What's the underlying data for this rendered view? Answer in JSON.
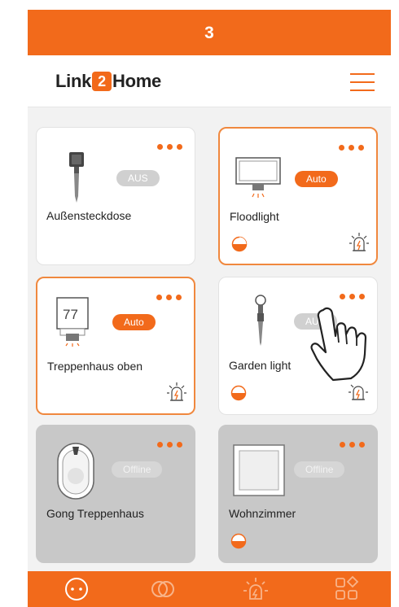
{
  "step": {
    "number": "3"
  },
  "header": {
    "logo_prefix": "Link",
    "logo_number": "2",
    "logo_suffix": "Home"
  },
  "devices": [
    {
      "name": "Außensteckdose",
      "status": "AUS",
      "state": "off",
      "icon": "outdoor-socket-icon"
    },
    {
      "name": "Floodlight",
      "status": "Auto",
      "state": "auto",
      "icon": "floodlight-icon"
    },
    {
      "name": "Treppenhaus oben",
      "status": "Auto",
      "state": "auto",
      "icon": "motion-light-icon",
      "display_value": "77"
    },
    {
      "name": "Garden light",
      "status": "AUS",
      "state": "off",
      "icon": "garden-light-icon"
    },
    {
      "name": "Gong Treppenhaus",
      "status": "Offline",
      "state": "offline",
      "icon": "doorbell-gong-icon"
    },
    {
      "name": "Wohnzimmer",
      "status": "Offline",
      "state": "offline",
      "icon": "wall-switch-icon"
    }
  ],
  "tabs": [
    {
      "name": "devices-tab",
      "icon": "devices-icon",
      "active": true
    },
    {
      "name": "groups-tab",
      "icon": "groups-icon",
      "active": false
    },
    {
      "name": "alarm-tab",
      "icon": "alarm-icon",
      "active": false
    },
    {
      "name": "apps-tab",
      "icon": "apps-icon",
      "active": false
    }
  ],
  "colors": {
    "accent": "#f26a1b",
    "card_active_border": "#f0883e",
    "offline_card": "#c8c8c8"
  }
}
